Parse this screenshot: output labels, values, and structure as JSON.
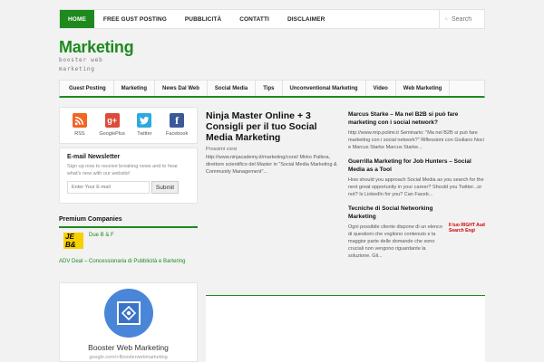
{
  "topnav": {
    "items": [
      "HOME",
      "FREE GUST POSTING",
      "PUBBLICITÀ",
      "CONTATTI",
      "DISCLAIMER"
    ],
    "search_placeholder": "Search"
  },
  "header": {
    "title": "Marketing",
    "description": "booster web marketing"
  },
  "mainmenu": {
    "items": [
      "Guest Posting",
      "Marketing",
      "News Dal Web",
      "Social Media",
      "Tips",
      "Unconventional Marketing",
      "Video",
      "Web Marketing"
    ]
  },
  "sidebar": {
    "social": [
      {
        "label": "RSS",
        "icon": "rss-icon",
        "color": "#f26522"
      },
      {
        "label": "GooglePlus",
        "icon": "google-plus-icon",
        "color": "#dd4b39"
      },
      {
        "label": "Twitter",
        "icon": "twitter-icon",
        "color": "#2da9e1"
      },
      {
        "label": "Facebook",
        "icon": "facebook-icon",
        "color": "#3b5998"
      }
    ],
    "newsletter": {
      "title": "E-mail Newsletter",
      "text": "Sign up now to receive breaking news and to hear what's new with our website!",
      "placeholder": "Enter Your E-mail",
      "button": "Submit"
    },
    "premium": {
      "title": "Premium Companies",
      "logo_text": "JE B&",
      "item": "Due B & F",
      "link": "ADV Deal – Concessionaria di Pubblicità e Bartering"
    },
    "gplus": {
      "name": "Booster Web Marketing",
      "url": "google.com/+Boosterwebmarketing"
    }
  },
  "featured": {
    "title": "Ninja Master Online + 3 Consigli per il tuo Social Media Marketing",
    "date": "Prossimi corsi",
    "excerpt": "http://www.ninjacademy.it/marketing/corsi/ Mirko Pallera, direttore scientifico del Master in \"Social Media Marketing & Community Management\"..."
  },
  "posts": [
    {
      "title": "Marcus Starke – Ma nel B2B si può fare marketing con i social network?",
      "excerpt": "http://www.mip.polimi.it Seminario: \"Ma nel B2B si può fare marketing con i social network?\" Riflessioni con Giuliano Noci e Marcus Starke Marcus Starke..."
    },
    {
      "title": "Guerrilla Marketing for Job Hunters – Social Media as a Tool",
      "excerpt": "How should you approach Social Media as you search for the next great opportunity in your career? Should you Twitter...or not? Is LinkedIn for you? Can Faceb..."
    },
    {
      "title": "Tecniche di Social Networking Marketing",
      "excerpt": "Ogni possibile cliente dispone di un elenco di questioni che vogliono contenuto e la maggior parte delle domande che sono cruciali non vengono riguardante la soluzione. Gli...",
      "thumb_text": "Il tuo RIGHT Aud Search Engi"
    }
  ],
  "colors": {
    "accent": "#1e8a1e"
  }
}
